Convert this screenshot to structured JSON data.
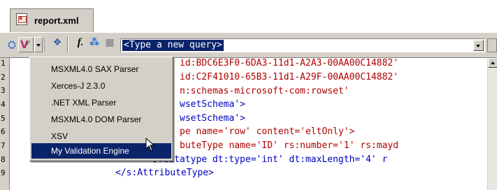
{
  "tab": {
    "label": "report.xml",
    "icon": "xml-file-icon"
  },
  "toolbar": {
    "query_text": "<Type a new query>"
  },
  "menu": {
    "items": [
      {
        "label": "MSXML4.0 SAX Parser"
      },
      {
        "label": "Xerces-J 2.3.0"
      },
      {
        "label": ".NET XML Parser"
      },
      {
        "label": "MSXML4.0 DOM Parser"
      },
      {
        "label": "XSV"
      },
      {
        "label": "My Validation Engine",
        "selected": true
      }
    ]
  },
  "editor": {
    "line_numbers": [
      "1",
      "2",
      "3",
      "4",
      "5",
      "6",
      "7",
      "8",
      "9"
    ],
    "lines": [
      {
        "a": "id:BDC6E3F0-6DA3-11d1-A2A3-00AA00C14882'"
      },
      {
        "a": "id:C2F41010-65B3-11d1-A29F-00AA00C14882'"
      },
      {
        "a": "n:schemas-microsoft-com:rowset'"
      },
      {
        "a": "wsetSchema'>"
      },
      {
        "a": "wsetSchema'>"
      },
      {
        "a": "pe name='row' content='eltOnly'>"
      },
      {
        "a": "buteType name='ID' rs:number='1' rs:mayd"
      },
      {
        "a": "<s:datatype dt:type='int' dt:maxLength='4' r"
      },
      {
        "a": "</s:AttributeType>"
      }
    ]
  },
  "colors": {
    "chrome": "#d4d0c8",
    "selection": "#0a246a",
    "tag": "#0000c0",
    "attr": "#b00000"
  }
}
